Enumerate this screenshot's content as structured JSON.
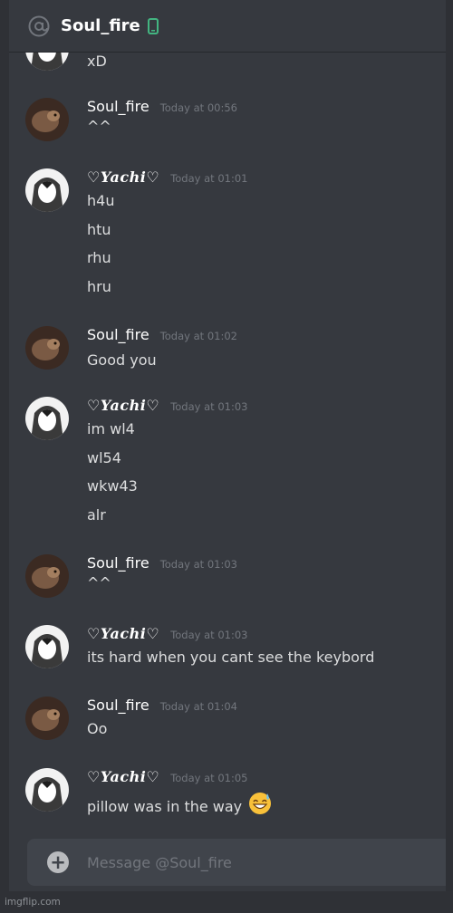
{
  "header": {
    "icon": "at-icon",
    "title": "Soul_fire",
    "status_icon": "mobile-phone-icon",
    "status_color": "#43b581"
  },
  "messages": [
    {
      "author": "",
      "timestamp": "",
      "lines": [
        "xD"
      ]
    },
    {
      "author": "Soul_fire",
      "timestamp": "Today at 00:56",
      "lines": [
        "^^"
      ]
    },
    {
      "author": "♡Yachi♡",
      "timestamp": "Today at 01:01",
      "lines": [
        "h4u",
        "htu",
        "rhu",
        "hru"
      ]
    },
    {
      "author": "Soul_fire",
      "timestamp": "Today at 01:02",
      "lines": [
        "Good you"
      ]
    },
    {
      "author": "♡Yachi♡",
      "timestamp": "Today at 01:03",
      "lines": [
        "im wl4",
        "wl54",
        "wkw43",
        "alr"
      ]
    },
    {
      "author": "Soul_fire",
      "timestamp": "Today at 01:03",
      "lines": [
        "^^"
      ]
    },
    {
      "author": "♡Yachi♡",
      "timestamp": "Today at 01:03",
      "lines": [
        "its hard when you cant see the keybord"
      ]
    },
    {
      "author": "Soul_fire",
      "timestamp": "Today at 01:04",
      "lines": [
        "Oo"
      ]
    },
    {
      "author": "♡Yachi♡",
      "timestamp": "Today at 01:05",
      "lines": [
        "pillow was in the way"
      ]
    }
  ],
  "emoji": "grinning-sweat-emoji",
  "composer": {
    "placeholder": "Message @Soul_fire",
    "add_icon": "plus-circle-icon"
  },
  "watermark": "imgflip.com",
  "colors": {
    "background": "#36393f",
    "input": "#40444b",
    "timestamp": "#72767d",
    "text": "#dcddde"
  }
}
